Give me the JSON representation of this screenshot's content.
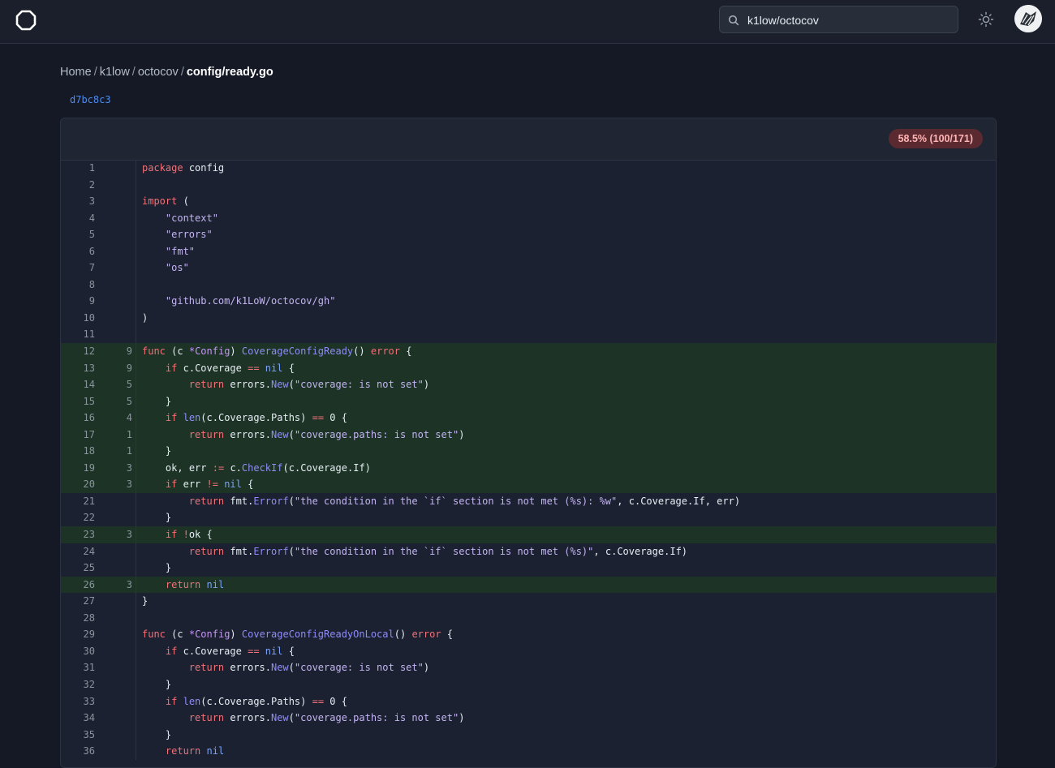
{
  "header": {
    "search_value": "k1low/octocov",
    "icons": {
      "logo": "octocov-logo-icon",
      "search": "search-icon",
      "theme": "sun-icon",
      "avatar": "avatar"
    }
  },
  "breadcrumb": {
    "home": "Home",
    "owner": "k1low",
    "repo": "octocov",
    "file": "config/ready.go",
    "separator": "/"
  },
  "commit": "d7bc8c3",
  "coverage_badge": "58.5% (100/171)",
  "colors": {
    "background": "#141925",
    "covered_line": "#1c3326",
    "badge_bg": "#5a2a30",
    "badge_text": "#ffb4b4",
    "link": "#4c8cf0"
  },
  "lines": [
    {
      "n": "1",
      "c": "",
      "code": "package config"
    },
    {
      "n": "2",
      "c": "",
      "code": ""
    },
    {
      "n": "3",
      "c": "",
      "code": "import ("
    },
    {
      "n": "4",
      "c": "",
      "code": "    \"context\""
    },
    {
      "n": "5",
      "c": "",
      "code": "    \"errors\""
    },
    {
      "n": "6",
      "c": "",
      "code": "    \"fmt\""
    },
    {
      "n": "7",
      "c": "",
      "code": "    \"os\""
    },
    {
      "n": "8",
      "c": "",
      "code": ""
    },
    {
      "n": "9",
      "c": "",
      "code": "    \"github.com/k1LoW/octocov/gh\""
    },
    {
      "n": "10",
      "c": "",
      "code": ")"
    },
    {
      "n": "11",
      "c": "",
      "code": ""
    },
    {
      "n": "12",
      "c": "9",
      "code": "func (c *Config) CoverageConfigReady() error {"
    },
    {
      "n": "13",
      "c": "9",
      "code": "    if c.Coverage == nil {"
    },
    {
      "n": "14",
      "c": "5",
      "code": "        return errors.New(\"coverage: is not set\")"
    },
    {
      "n": "15",
      "c": "5",
      "code": "    }"
    },
    {
      "n": "16",
      "c": "4",
      "code": "    if len(c.Coverage.Paths) == 0 {"
    },
    {
      "n": "17",
      "c": "1",
      "code": "        return errors.New(\"coverage.paths: is not set\")"
    },
    {
      "n": "18",
      "c": "1",
      "code": "    }"
    },
    {
      "n": "19",
      "c": "3",
      "code": "    ok, err := c.CheckIf(c.Coverage.If)"
    },
    {
      "n": "20",
      "c": "3",
      "code": "    if err != nil {"
    },
    {
      "n": "21",
      "c": "",
      "code": "        return fmt.Errorf(\"the condition in the `if` section is not met (%s): %w\", c.Coverage.If, err)"
    },
    {
      "n": "22",
      "c": "",
      "code": "    }"
    },
    {
      "n": "23",
      "c": "3",
      "code": "    if !ok {"
    },
    {
      "n": "24",
      "c": "",
      "code": "        return fmt.Errorf(\"the condition in the `if` section is not met (%s)\", c.Coverage.If)"
    },
    {
      "n": "25",
      "c": "",
      "code": "    }"
    },
    {
      "n": "26",
      "c": "3",
      "code": "    return nil"
    },
    {
      "n": "27",
      "c": "",
      "code": "}"
    },
    {
      "n": "28",
      "c": "",
      "code": ""
    },
    {
      "n": "29",
      "c": "",
      "code": "func (c *Config) CoverageConfigReadyOnLocal() error {"
    },
    {
      "n": "30",
      "c": "",
      "code": "    if c.Coverage == nil {"
    },
    {
      "n": "31",
      "c": "",
      "code": "        return errors.New(\"coverage: is not set\")"
    },
    {
      "n": "32",
      "c": "",
      "code": "    }"
    },
    {
      "n": "33",
      "c": "",
      "code": "    if len(c.Coverage.Paths) == 0 {"
    },
    {
      "n": "34",
      "c": "",
      "code": "        return errors.New(\"coverage.paths: is not set\")"
    },
    {
      "n": "35",
      "c": "",
      "code": "    }"
    },
    {
      "n": "36",
      "c": "",
      "code": "    return nil"
    }
  ]
}
